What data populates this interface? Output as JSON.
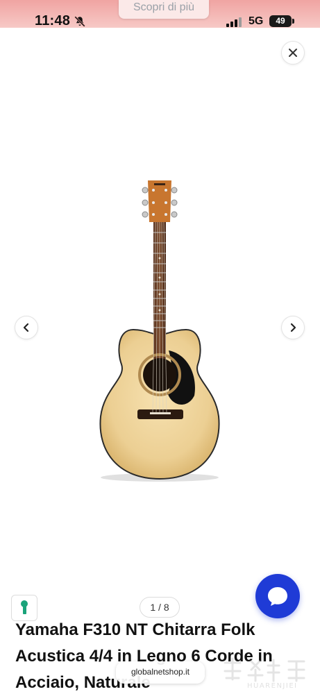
{
  "status_bar": {
    "time": "11:48",
    "network": "5G",
    "battery": "49",
    "bell_icon": "bell-muted-icon",
    "signal_icon": "cellular-signal-icon"
  },
  "top_pill": {
    "label": "Scopri di più"
  },
  "gallery": {
    "page_indicator": "1 / 8",
    "close_icon": "close-icon",
    "prev_icon": "chevron-left-icon",
    "next_icon": "chevron-right-icon",
    "image_icon": "guitar-product-image"
  },
  "product": {
    "title_lines": [
      "Yamaha F310 NT Chitarra Folk",
      "Acustica 4/4 in Legno 6 Corde in",
      "Acciaio, Naturale"
    ]
  },
  "browser": {
    "url": "globalnetshop.it"
  },
  "watermark": {
    "text": "HUARENJIEI"
  },
  "colors": {
    "status_bar_bg": "#f0a4a2",
    "chat_button": "#1f3bd6",
    "thumb_icon": "#1aa37a"
  }
}
